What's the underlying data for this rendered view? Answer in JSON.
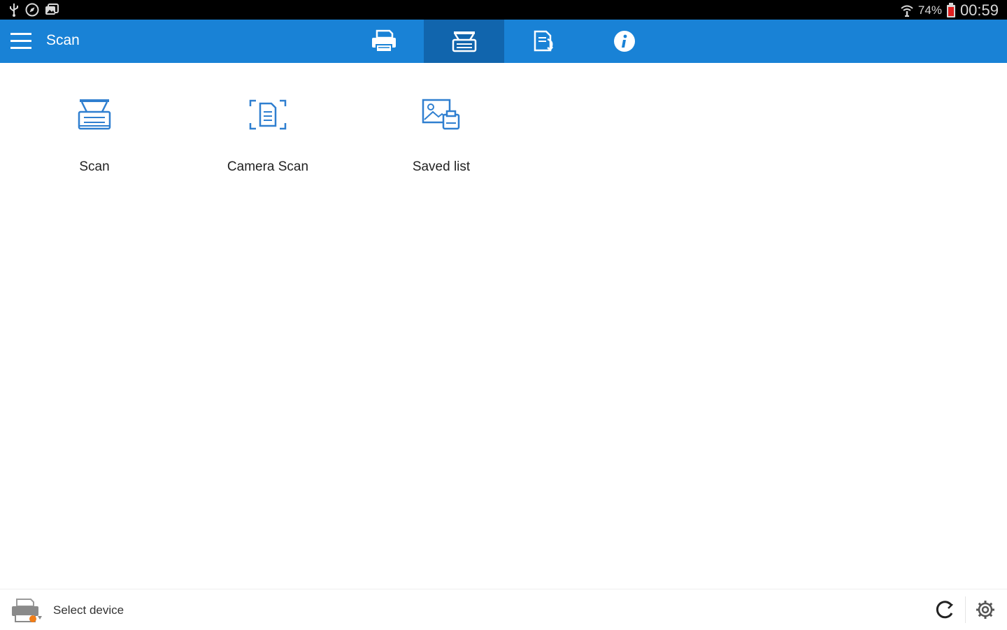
{
  "status_bar": {
    "left_icons": [
      "usb-icon",
      "compass-icon",
      "photos-icon"
    ],
    "battery_percent": "74%",
    "time": "00:59",
    "right_icons": [
      "wifi-icon",
      "battery-icon"
    ]
  },
  "app_bar": {
    "title": "Scan",
    "tabs": [
      {
        "icon": "printer-icon",
        "selected": false
      },
      {
        "icon": "scanner-icon",
        "selected": true
      },
      {
        "icon": "document-transfer-icon",
        "selected": false
      },
      {
        "icon": "info-icon",
        "selected": false
      }
    ],
    "accent_color": "#1982d6",
    "selected_tab_color": "#1165ad"
  },
  "tiles": [
    {
      "label": "Scan",
      "icon": "scanner-icon"
    },
    {
      "label": "Camera Scan",
      "icon": "camera-scan-icon"
    },
    {
      "label": "Saved list",
      "icon": "saved-list-icon"
    }
  ],
  "bottom_bar": {
    "device_label": "Select device",
    "icons": [
      "printer-warning-icon",
      "refresh-icon",
      "settings-icon"
    ]
  }
}
